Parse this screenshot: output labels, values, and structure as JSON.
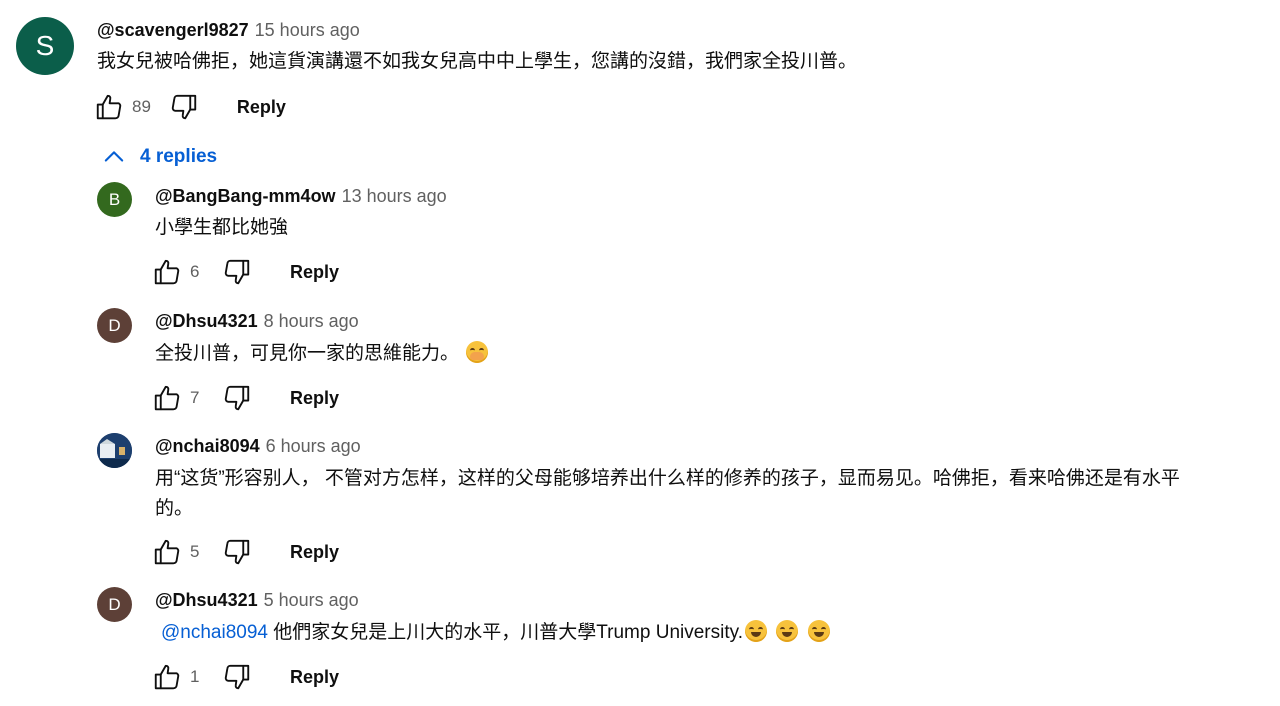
{
  "top_comment": {
    "avatar_letter": "S",
    "avatar_color": "#0b5e4a",
    "author": "@scavengerl9827",
    "time": "15 hours ago",
    "text": "我女兒被哈佛拒，她這貨演講還不如我女兒高中中上學生，您講的沒錯，我們家全投川普。",
    "likes": "89",
    "reply_label": "Reply"
  },
  "replies_toggle": {
    "label": "4 replies",
    "icon": "chevron-up-icon"
  },
  "replies": [
    {
      "avatar_letter": "B",
      "avatar_color": "#33691e",
      "author": "@BangBang-mm4ow",
      "time": "13 hours ago",
      "text": "小學生都比她強",
      "likes": "6",
      "reply_label": "Reply"
    },
    {
      "avatar_letter": "D",
      "avatar_color": "#5d4037",
      "author": "@Dhsu4321",
      "time": "8 hours ago",
      "text": "全投川普，可見你一家的思維能力。",
      "emoji": "hand-over-mouth-emoji",
      "likes": "7",
      "reply_label": "Reply"
    },
    {
      "avatar_image": "landscape-photo-avatar",
      "avatar_color": "#1d3f6e",
      "author": "@nchai8094",
      "time": "6 hours ago",
      "text_line1": "用“这货”形容别人， 不管对方怎样，这样的父母能够培养出什么样的修养的孩子，显而易见。哈佛拒，看来哈佛还是有水平",
      "text_line2": "的。",
      "likes": "5",
      "reply_label": "Reply"
    },
    {
      "avatar_letter": "D",
      "avatar_color": "#5d4037",
      "author": "@Dhsu4321",
      "time": "5 hours ago",
      "mention": "@nchai8094",
      "text": " 他們家女兒是上川大的水平，川普大學Trump University.",
      "emoji": "rolling-on-floor-laughing-emoji x3",
      "likes": "1",
      "reply_label": "Reply"
    }
  ],
  "icons": {
    "like": "thumbs-up-icon",
    "dislike": "thumbs-down-icon"
  }
}
